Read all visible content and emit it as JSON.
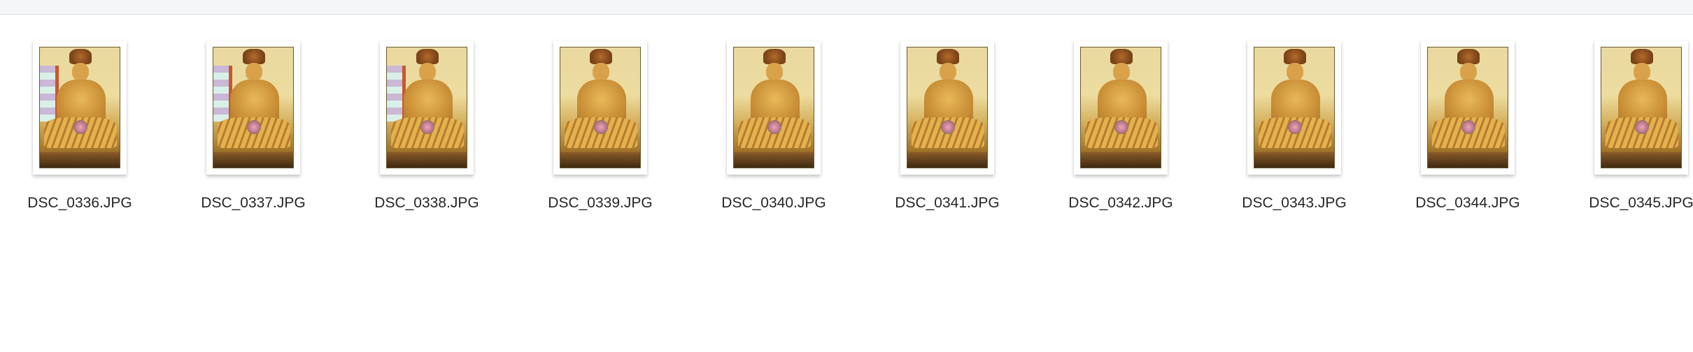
{
  "files": [
    {
      "name": "DSC_0336.JPG",
      "type": "jpeg-image-thumbnail"
    },
    {
      "name": "DSC_0337.JPG",
      "type": "jpeg-image-thumbnail"
    },
    {
      "name": "DSC_0338.JPG",
      "type": "jpeg-image-thumbnail"
    },
    {
      "name": "DSC_0339.JPG",
      "type": "jpeg-image-thumbnail"
    },
    {
      "name": "DSC_0340.JPG",
      "type": "jpeg-image-thumbnail"
    },
    {
      "name": "DSC_0341.JPG",
      "type": "jpeg-image-thumbnail"
    },
    {
      "name": "DSC_0342.JPG",
      "type": "jpeg-image-thumbnail"
    },
    {
      "name": "DSC_0343.JPG",
      "type": "jpeg-image-thumbnail"
    },
    {
      "name": "DSC_0344.JPG",
      "type": "jpeg-image-thumbnail"
    },
    {
      "name": "DSC_0345.JPG",
      "type": "jpeg-image-thumbnail"
    }
  ]
}
